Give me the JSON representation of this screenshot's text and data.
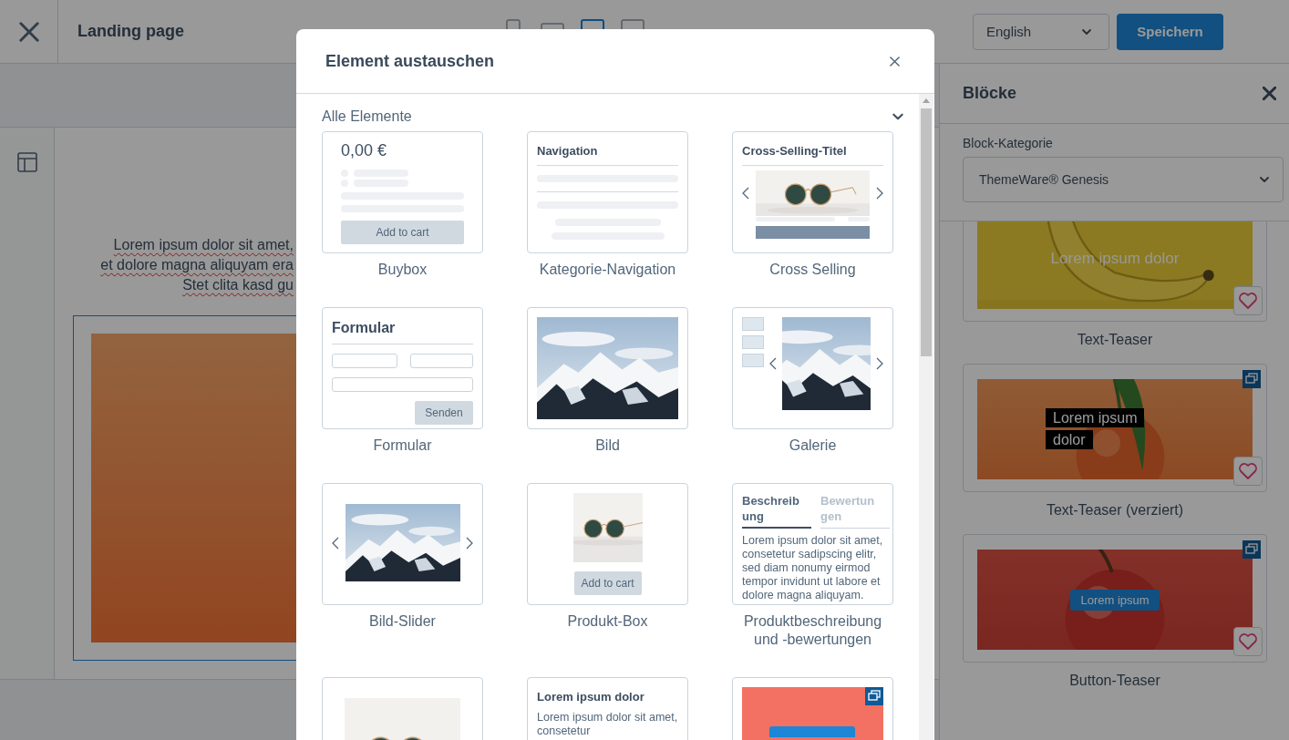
{
  "topbar": {
    "title": "Landing page",
    "devices": [
      {
        "selected": false
      },
      {
        "selected": false
      },
      {
        "selected": true
      },
      {
        "selected": false
      }
    ],
    "language": "English",
    "save": "Speichern"
  },
  "canvas": {
    "text_lines": [
      "Lorem ipsum dolor sit amet,",
      "et dolore magna aliquyam era",
      "Stet clita kasd gu"
    ]
  },
  "blocks_panel": {
    "title": "Blöcke",
    "category_label": "Block-Kategorie",
    "category": "ThemeWare® Genesis",
    "blocks": [
      {
        "kind": "text",
        "label": "Text-Teaser",
        "overlay_text": "Lorem ipsum dolor",
        "stacked": false
      },
      {
        "kind": "boxed",
        "label": "Text-Teaser (verziert)",
        "overlay_text": "Lorem ipsum dolor",
        "stacked": true
      },
      {
        "kind": "button",
        "label": "Button-Teaser",
        "overlay_text": "Lorem ipsum",
        "stacked": true
      }
    ]
  },
  "modal": {
    "title": "Element austauschen",
    "section": "Alle Elemente",
    "elements": [
      {
        "kind": "buybox",
        "label": "Buybox",
        "price": "0,00 €",
        "button": "Add to cart"
      },
      {
        "kind": "navigation",
        "label": "Kategorie-Navigation",
        "heading": "Navigation"
      },
      {
        "kind": "cross-selling",
        "label": "Cross Selling",
        "heading": "Cross-Selling-Titel"
      },
      {
        "kind": "form",
        "label": "Formular",
        "heading": "Formular",
        "button": "Senden"
      },
      {
        "label": "Bild"
      },
      {
        "kind": "gallery",
        "label": "Galerie"
      },
      {
        "kind": "slider",
        "label": "Bild-Slider"
      },
      {
        "kind": "product-box",
        "label": "Produkt-Box",
        "button": "Add to cart"
      },
      {
        "kind": "description",
        "label": "Produktbeschreibung und -bewertungen",
        "tabs": [
          {
            "label": "Beschreibung",
            "selected": true
          },
          {
            "label": "Bewertungen",
            "selected": false
          }
        ],
        "text": "Lorem ipsum dolor sit amet, consetetur sadipscing elitr, sed diam nonumy eirmod tempor invidunt ut labore et dolore magna aliquyam."
      },
      {
        "kind": "image-glasses"
      },
      {
        "kind": "text",
        "heading": "Lorem ipsum dolor",
        "text": "Lorem ipsum dolor sit amet, consetetur"
      },
      {
        "kind": "teaser"
      }
    ]
  }
}
